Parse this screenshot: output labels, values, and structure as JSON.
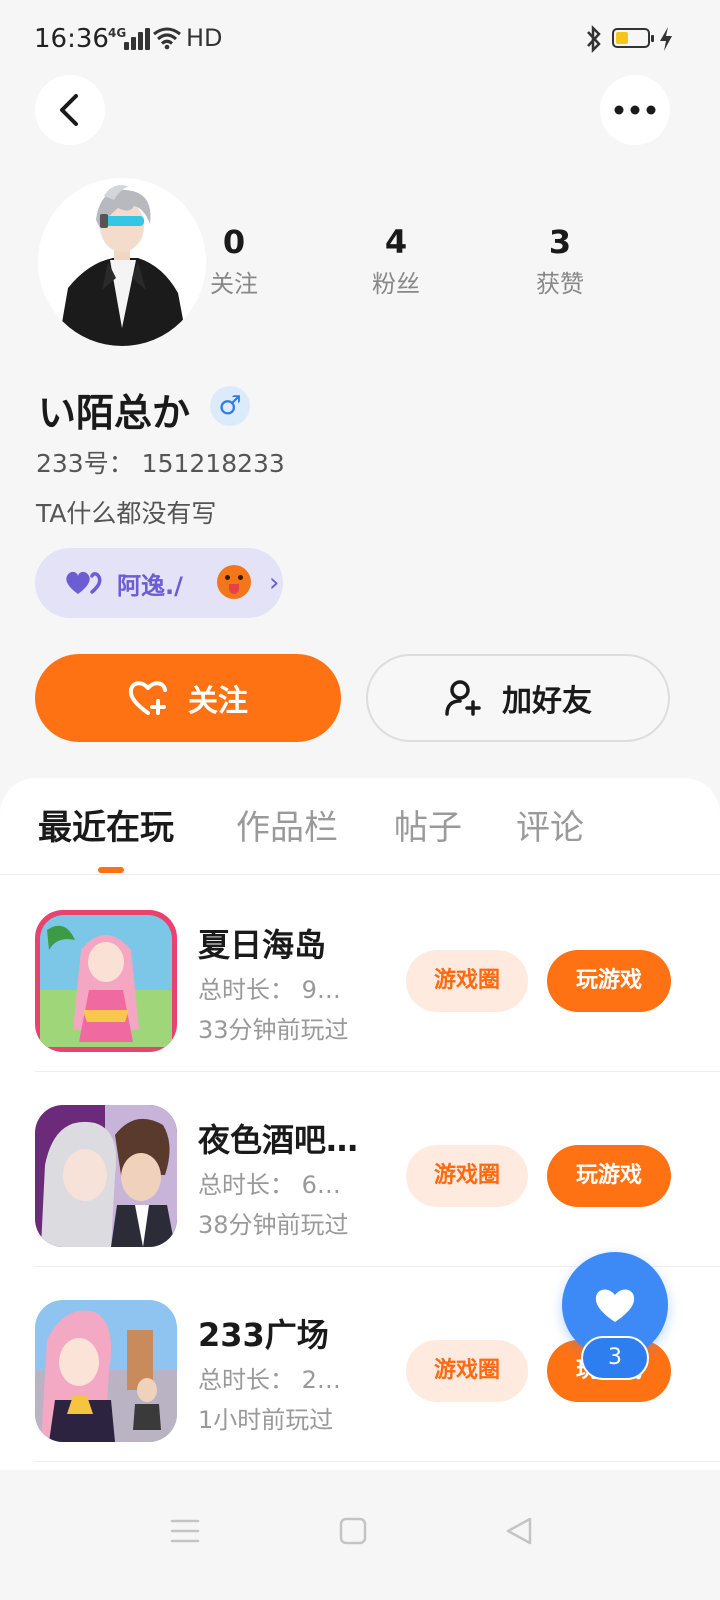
{
  "status_bar": {
    "time": "16:36",
    "network": "4G",
    "hd": "HD",
    "battery_level": 0.35
  },
  "header": {
    "back_icon": "chevron-left-icon",
    "more_icon": "more-horizontal-icon"
  },
  "profile": {
    "stats": [
      {
        "value": "0",
        "label": "关注"
      },
      {
        "value": "4",
        "label": "粉丝"
      },
      {
        "value": "3",
        "label": "获赞"
      }
    ],
    "nickname": "い陌总か",
    "gender_symbol": "♂",
    "user_id": "233号： 151218233",
    "bio": "TA什么都没有写",
    "friend_chip": {
      "name": "阿逸./",
      "chevron": "›"
    }
  },
  "actions": {
    "follow_label": "关注",
    "add_friend_label": "加好友"
  },
  "tabs": [
    "最近在玩",
    "作品栏",
    "帖子",
    "评论"
  ],
  "games": [
    {
      "title": "夏日海岛",
      "duration": "总时长： 9…",
      "last_played": "33分钟前玩过",
      "circle_label": "游戏圈",
      "play_label": "玩游戏"
    },
    {
      "title": "夜色酒吧…",
      "duration": "总时长： 6…",
      "last_played": "38分钟前玩过",
      "circle_label": "游戏圈",
      "play_label": "玩游戏"
    },
    {
      "title": "233广场",
      "duration": "总时长： 2…",
      "last_played": "1小时前玩过",
      "circle_label": "游戏圈",
      "play_label": "玩游戏"
    }
  ],
  "fab": {
    "icon": "heart-icon",
    "badge": "3"
  },
  "colors": {
    "accent": "#ff7214",
    "accent_light": "#ffeadf",
    "fab_blue": "#3d8af7",
    "chip_bg": "#e4e2f6",
    "chip_text": "#6c5dd3"
  }
}
